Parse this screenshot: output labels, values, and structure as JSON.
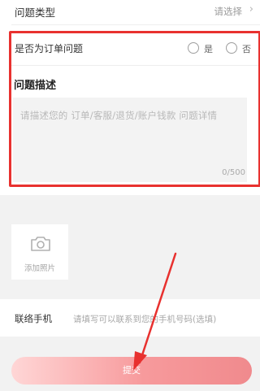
{
  "form": {
    "issue_type_label": "问题类型",
    "issue_type_value": "请选择",
    "order_question_label": "是否为订单问题",
    "option_yes": "是",
    "option_no": "否",
    "description_title": "问题描述",
    "description_placeholder": "请描述您的 订单/客服/退货/账户钱款 问题详情",
    "char_count": "0/500",
    "add_photo_label": "添加照片",
    "phone_label": "联络手机",
    "phone_placeholder": "请填写可以联系到您的手机号码(选填)",
    "submit_label": "提交"
  },
  "colors": {
    "highlight": "#e8312f",
    "submit_gradient_end": "#f08a8d"
  },
  "icons": [
    "chevron-right-icon",
    "camera-icon",
    "radio-icon",
    "annotation-arrow"
  ]
}
